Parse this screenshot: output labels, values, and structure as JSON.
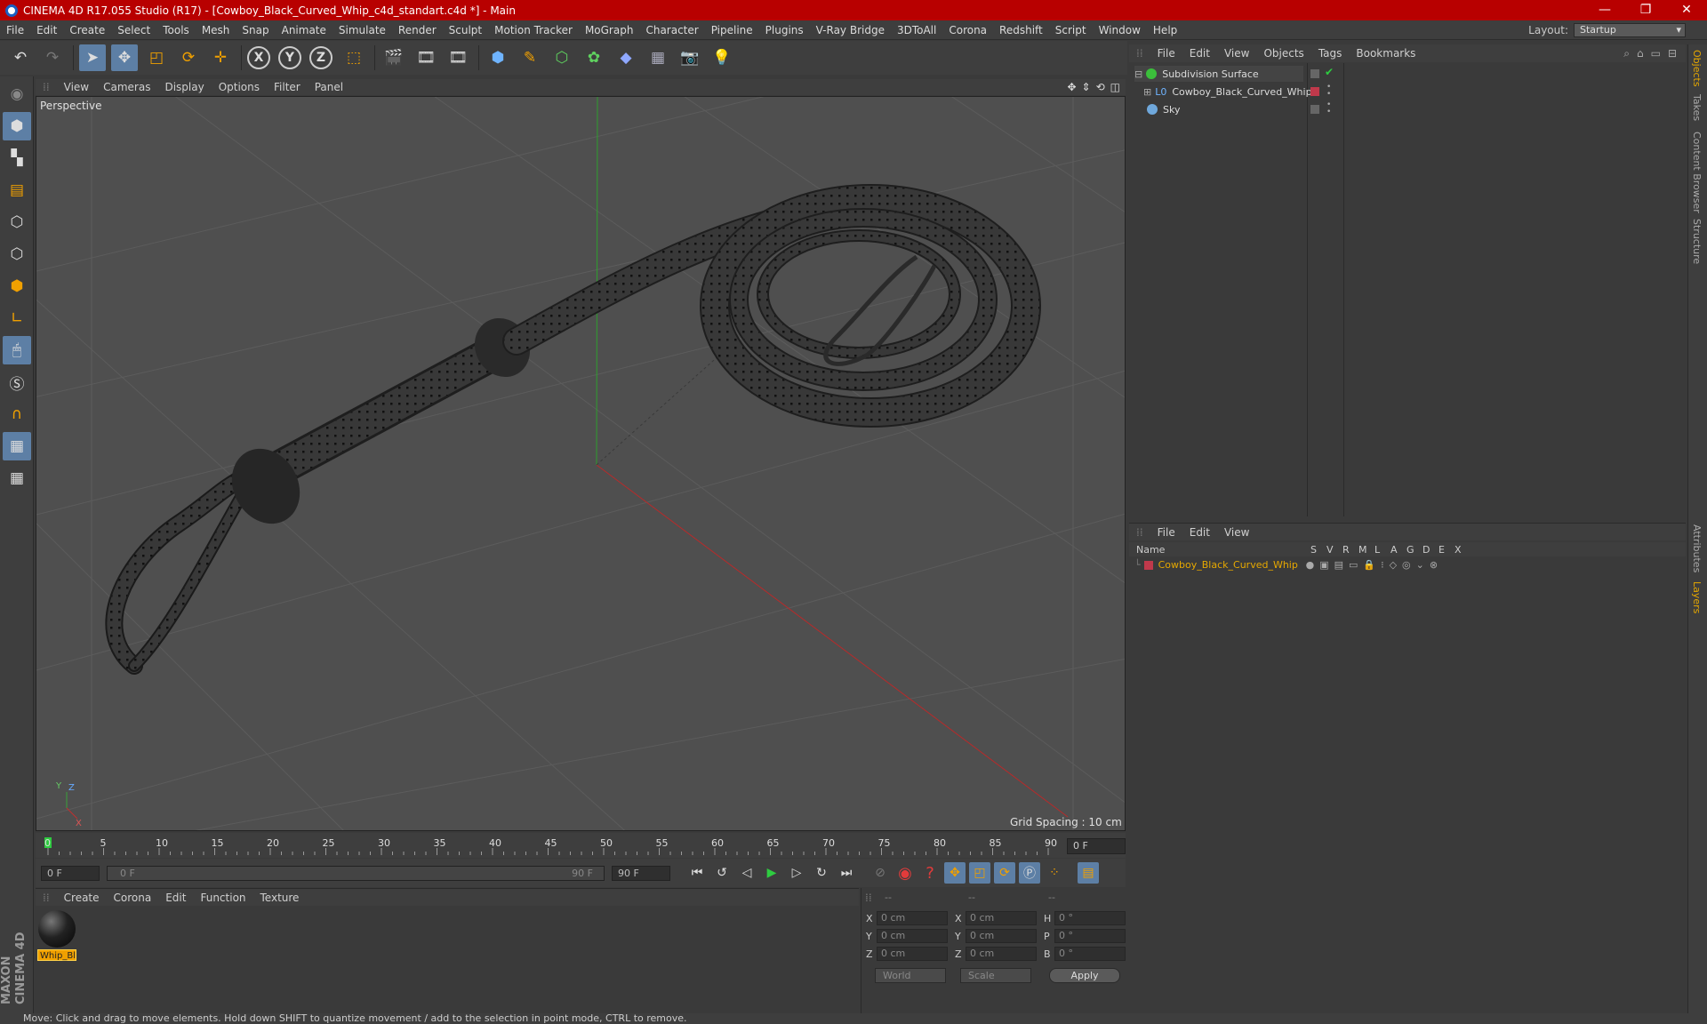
{
  "window": {
    "title": "CINEMA 4D R17.055 Studio (R17) - [Cowboy_Black_Curved_Whip_c4d_standart.c4d *] - Main",
    "controls": [
      "—",
      "❐",
      "✕"
    ]
  },
  "menu": [
    "File",
    "Edit",
    "Create",
    "Select",
    "Tools",
    "Mesh",
    "Snap",
    "Animate",
    "Simulate",
    "Render",
    "Sculpt",
    "Motion Tracker",
    "MoGraph",
    "Character",
    "Pipeline",
    "Plugins",
    "V-Ray Bridge",
    "3DToAll",
    "Corona",
    "Redshift",
    "Script",
    "Window",
    "Help"
  ],
  "layout": {
    "label": "Layout:",
    "value": "Startup"
  },
  "toolbar": {
    "axis": [
      "X",
      "Y",
      "Z"
    ]
  },
  "viewport": {
    "menu": [
      "View",
      "Cameras",
      "Display",
      "Options",
      "Filter",
      "Panel"
    ],
    "label": "Perspective",
    "grid_spacing": "Grid Spacing : 10 cm"
  },
  "timeline": {
    "ticks": [
      "0",
      "5",
      "10",
      "15",
      "20",
      "25",
      "30",
      "35",
      "40",
      "45",
      "50",
      "55",
      "60",
      "65",
      "70",
      "75",
      "80",
      "85",
      "90"
    ],
    "current_frame": "0 F"
  },
  "transport": {
    "start": "0 F",
    "range_start": "0 F",
    "range_end": "90 F",
    "end": "90 F"
  },
  "materials": {
    "menu": [
      "Create",
      "Corona",
      "Edit",
      "Function",
      "Texture"
    ],
    "items": [
      {
        "name": "Whip_Bl"
      }
    ]
  },
  "coordinates": {
    "headers": [
      "--",
      "--",
      "--"
    ],
    "rows": [
      {
        "a": "X",
        "av": "0 cm",
        "b": "X",
        "bv": "0 cm",
        "c": "H",
        "cv": "0 °"
      },
      {
        "a": "Y",
        "av": "0 cm",
        "b": "Y",
        "bv": "0 cm",
        "c": "P",
        "cv": "0 °"
      },
      {
        "a": "Z",
        "av": "0 cm",
        "b": "Z",
        "bv": "0 cm",
        "c": "B",
        "cv": "0 °"
      }
    ],
    "mode": "World",
    "scale": "Scale",
    "apply": "Apply"
  },
  "objects": {
    "menu": [
      "File",
      "Edit",
      "View",
      "Objects",
      "Tags",
      "Bookmarks"
    ],
    "items": [
      {
        "name": "Subdivision Surface",
        "color": "#5fd15f"
      },
      {
        "name": "Cowboy_Black_Curved_Whip",
        "color": "#dcdcdc"
      },
      {
        "name": "Sky",
        "color": "#6fa8dc"
      }
    ]
  },
  "layers": {
    "menu": [
      "File",
      "Edit",
      "View"
    ],
    "headers": [
      "Name",
      "S",
      "V",
      "R",
      "M",
      "L",
      "A",
      "G",
      "D",
      "E",
      "X"
    ],
    "items": [
      {
        "name": "Cowboy_Black_Curved_Whip",
        "color": "#e6a800",
        "swatch": "#c0394b"
      }
    ]
  },
  "right_tabs": [
    "Objects",
    "Takes",
    "Content Browser",
    "Structure",
    "Attributes",
    "Layers"
  ],
  "brand": {
    "text": "MAXON CINEMA 4D"
  },
  "status": "Move: Click and drag to move elements. Hold down SHIFT to quantize movement / add to the selection in point mode, CTRL to remove."
}
